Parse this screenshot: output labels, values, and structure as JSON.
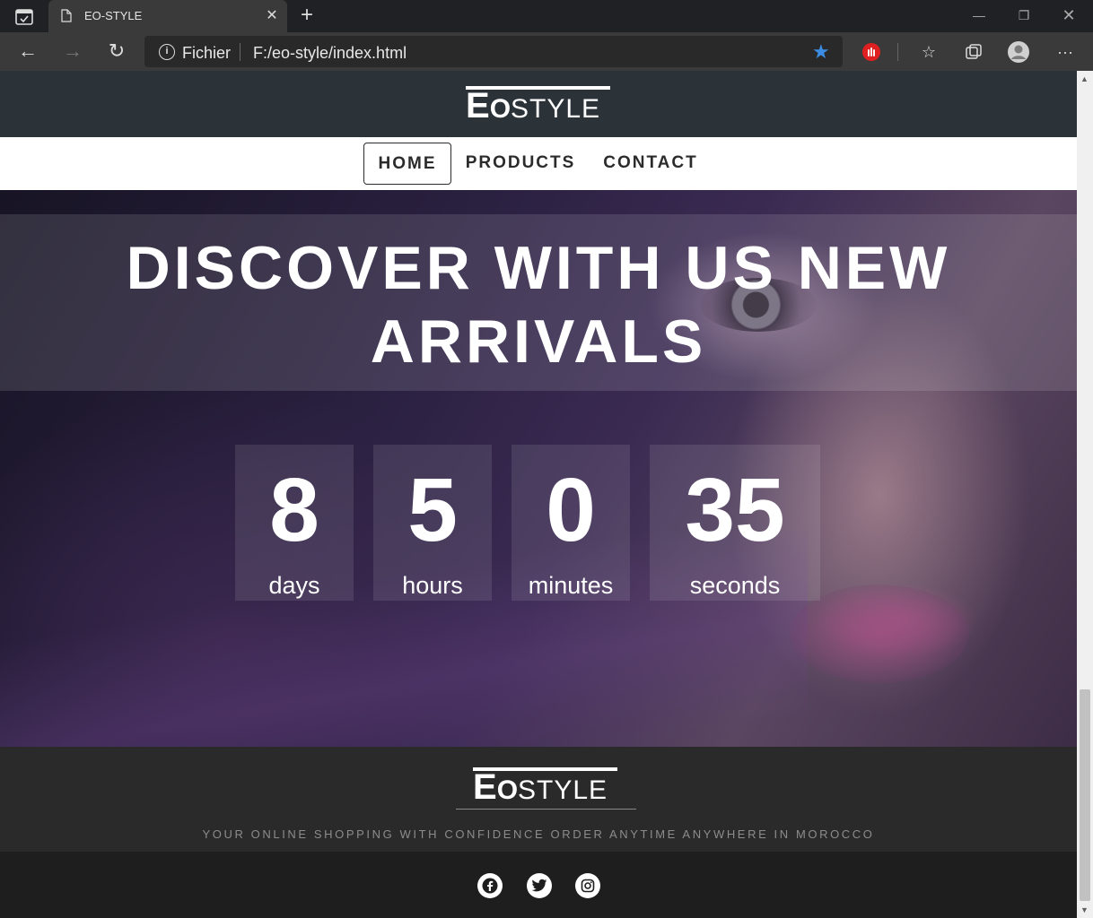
{
  "browser": {
    "tab_title": "EO-STYLE",
    "address_label": "Fichier",
    "url": "F:/eo-style/index.html"
  },
  "site": {
    "logo": {
      "e": "E",
      "o": "O",
      "rest": "STYLE"
    },
    "nav": [
      {
        "label": "HOME",
        "active": true
      },
      {
        "label": "PRODUCTS",
        "active": false
      },
      {
        "label": "CONTACT",
        "active": false
      }
    ],
    "hero_title": "DISCOVER WITH US NEW ARRIVALS",
    "countdown": [
      {
        "value": "8",
        "label": "days"
      },
      {
        "value": "5",
        "label": "hours"
      },
      {
        "value": "0",
        "label": "minutes"
      },
      {
        "value": "35",
        "label": "seconds"
      }
    ],
    "footer_tagline": "YOUR ONLINE SHOPPING WITH CONFIDENCE ORDER ANYTIME ANYWHERE IN MOROCCO",
    "social": [
      "facebook-icon",
      "twitter-icon",
      "instagram-icon"
    ]
  },
  "colors": {
    "header": "#2b3238",
    "footer": "#2a2a2a",
    "accent_star": "#3b8de3"
  }
}
